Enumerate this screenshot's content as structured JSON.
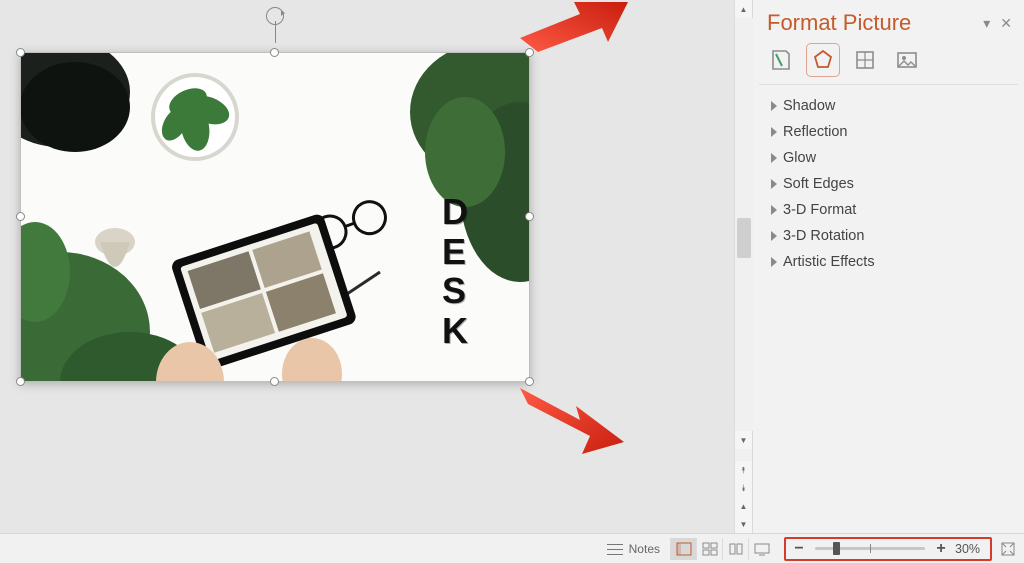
{
  "panel": {
    "title": "Format Picture",
    "sections": [
      {
        "label": "Shadow"
      },
      {
        "label": "Reflection"
      },
      {
        "label": "Glow"
      },
      {
        "label": "Soft Edges"
      },
      {
        "label": "3-D Format"
      },
      {
        "label": "3-D Rotation"
      },
      {
        "label": "Artistic Effects"
      }
    ],
    "icons": {
      "fill": "fill-line-icon",
      "effects": "effects-icon",
      "size": "size-properties-icon",
      "picture": "picture-icon"
    },
    "active_tab": 1
  },
  "slide": {
    "vertical_text": [
      "D",
      "E",
      "S",
      "K"
    ]
  },
  "status": {
    "notes": "Notes",
    "zoom_percent": "30%"
  },
  "colors": {
    "accent": "#c55a2b",
    "highlight": "#d43b2a"
  }
}
